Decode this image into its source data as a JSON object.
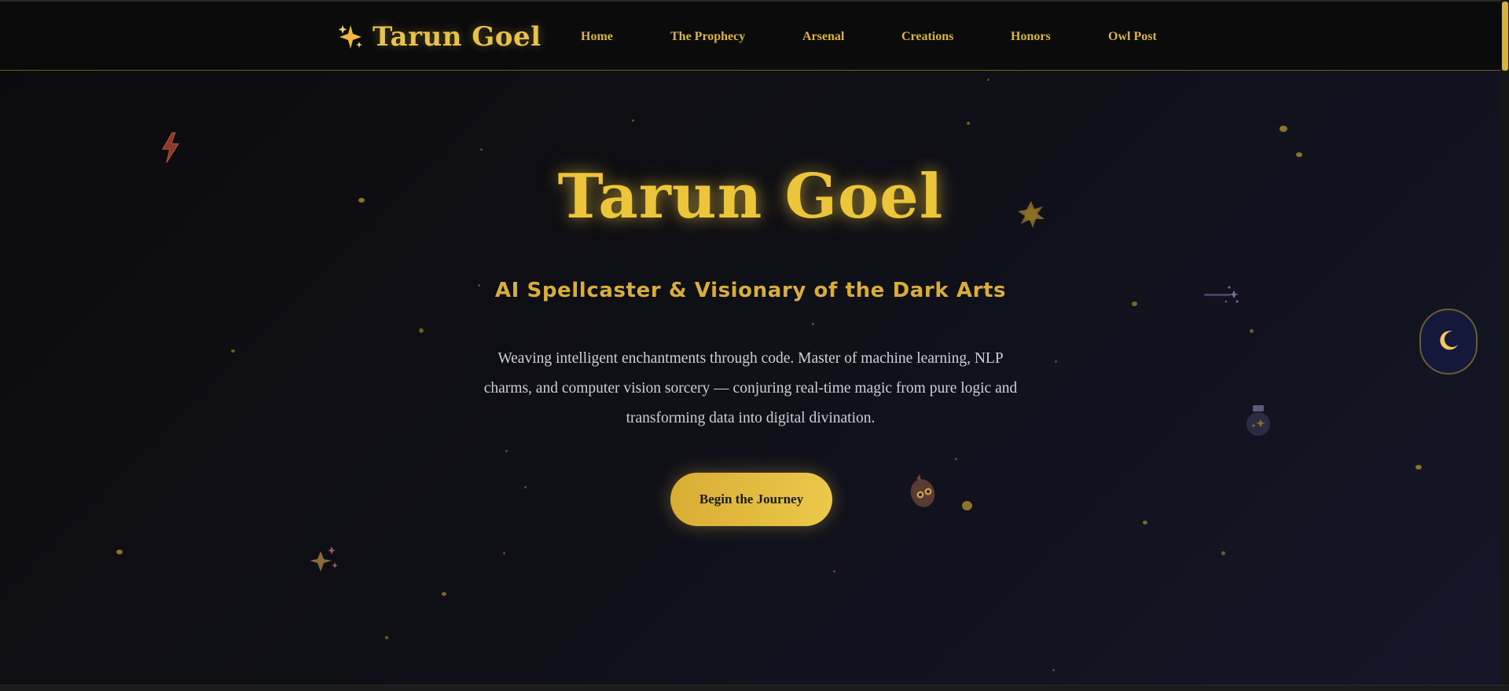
{
  "navbar": {
    "brand": {
      "icon": "sparkles-icon",
      "name": "Tarun Goel"
    },
    "links": [
      {
        "label": "Home"
      },
      {
        "label": "The Prophecy"
      },
      {
        "label": "Arsenal"
      },
      {
        "label": "Creations"
      },
      {
        "label": "Honors"
      },
      {
        "label": "Owl Post"
      }
    ]
  },
  "hero": {
    "title": "Tarun Goel",
    "subtitle": "AI Spellcaster & Visionary of the Dark Arts",
    "description": "Weaving intelligent enchantments through code. Master of machine learning, NLP charms, and computer vision sorcery — conjuring real-time magic from pure logic and transforming data into digital divination.",
    "cta_label": "Begin the Journey"
  },
  "theme_toggle": {
    "icon": "crescent-moon-icon"
  },
  "decorations": [
    {
      "icon": "lightning-bolt-icon"
    },
    {
      "icon": "splat-star-icon"
    },
    {
      "icon": "magic-wand-icon"
    },
    {
      "icon": "potion-bottle-icon"
    },
    {
      "icon": "owl-icon"
    },
    {
      "icon": "sparkle-stars-icon"
    }
  ],
  "colors": {
    "accent_gold": "#ecc53a",
    "nav_gold": "#d9b440",
    "background_dark": "#0d0d12",
    "text_light": "#cfcfd6",
    "toggle_bg": "#14183a"
  }
}
